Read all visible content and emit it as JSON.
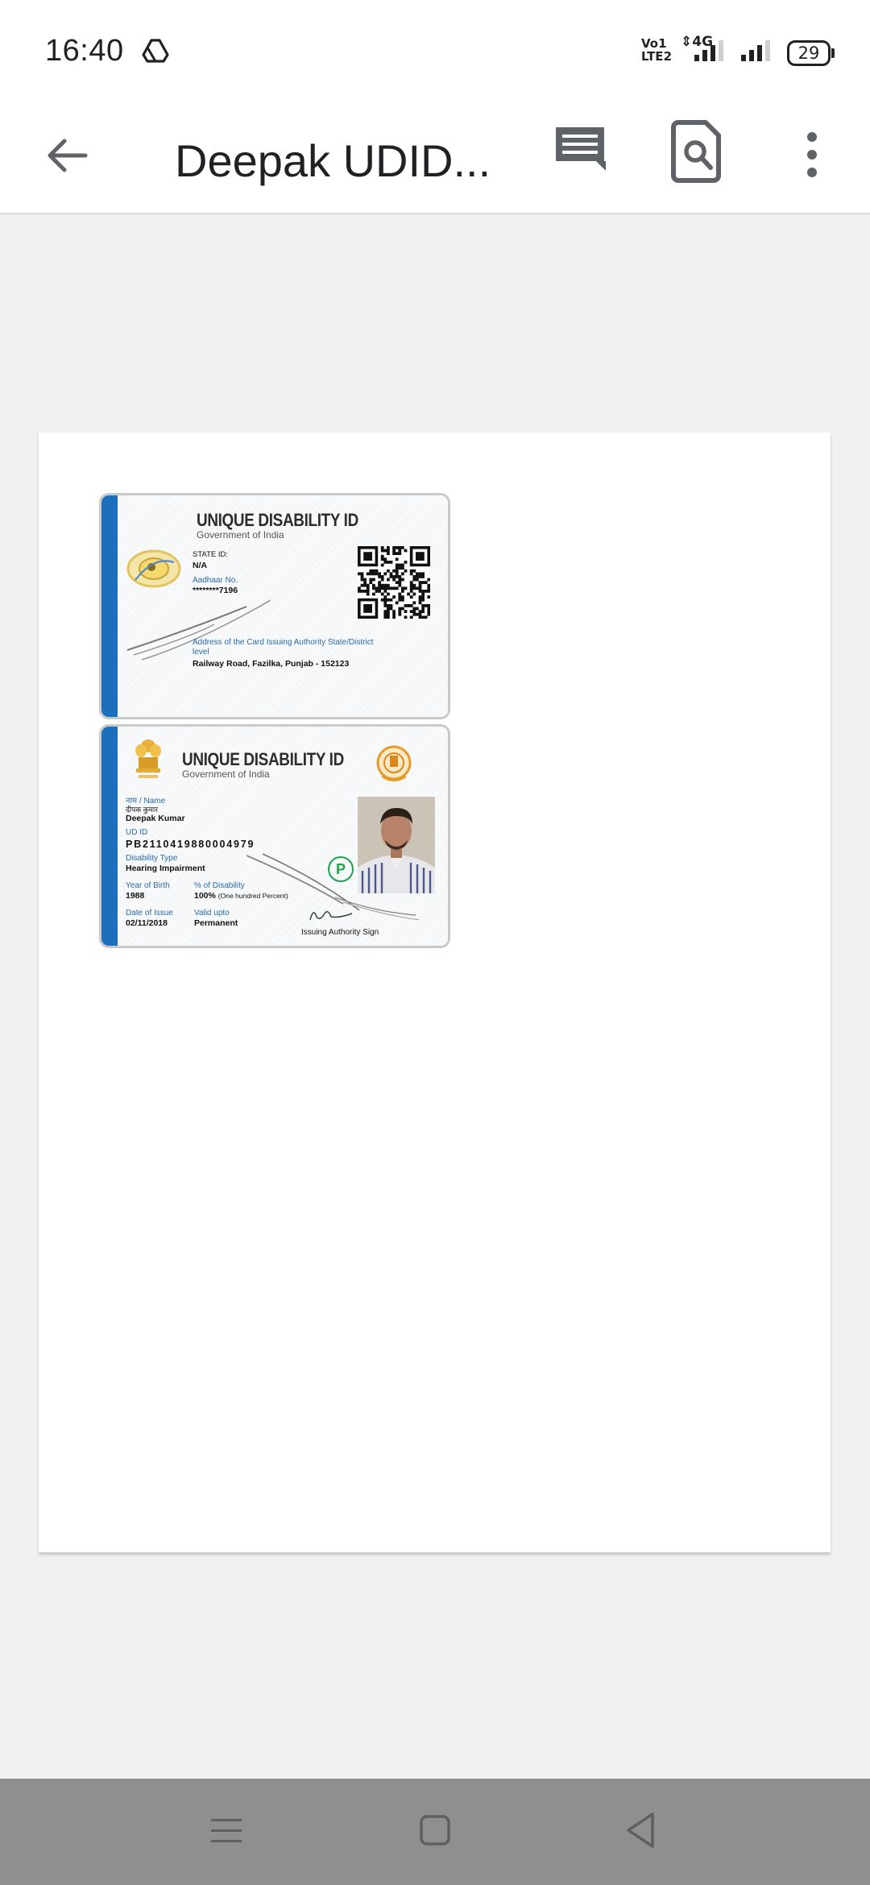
{
  "status_bar": {
    "time": "16:40",
    "network_label": "4G",
    "volte_line1": "Vo",
    "volte_line2": "LTE",
    "sim1": "1",
    "sim2": "2",
    "battery_level": "29",
    "icons": [
      "drive-icon",
      "volte-icon",
      "signal-icon",
      "signal-icon",
      "battery-icon"
    ]
  },
  "app_bar": {
    "title": "Deepak UDID...",
    "icons": [
      "back-arrow-icon",
      "comment-icon",
      "find-in-page-icon",
      "more-vert-icon"
    ]
  },
  "document": {
    "front_card": {
      "title": "UNIQUE DISABILITY ID",
      "subtitle": "Government of India",
      "state_id_label": "STATE ID:",
      "state_id_value": "N/A",
      "aadhaar_label": "Aadhaar No.",
      "aadhaar_value": "********7196",
      "address_label_line1": "Address of the Card Issuing Authority State/District",
      "address_label_line2": "level",
      "address_value": "Railway Road, Fazilka, Punjab - 152123"
    },
    "back_card": {
      "title": "UNIQUE DISABILITY ID",
      "subtitle": "Government of India",
      "name_label": "नाम / Name",
      "name_local": "दीपक कुमार",
      "name_value": "Deepak Kumar",
      "udid_label": "UD ID",
      "udid_value": "PB2110419880004979",
      "disability_type_label": "Disability Type",
      "disability_type_value": "Hearing Impairment",
      "year_of_birth_label": "Year of Birth",
      "year_of_birth_value": "1988",
      "percent_label": "% of Disability",
      "percent_value": "100%",
      "percent_words": "(One hundred Percent)",
      "date_of_issue_label": "Date of Issue",
      "date_of_issue_value": "02/11/2018",
      "valid_upto_label": "Valid upto",
      "valid_upto_value": "Permanent",
      "sign_label": "Issuing Authority Sign",
      "badge_letter": "P"
    }
  },
  "nav_bar": {
    "icons": [
      "recent-apps-icon",
      "home-icon",
      "back-icon"
    ]
  },
  "colors": {
    "card_band": "#1b6fbd",
    "label_blue": "#2a6aa6",
    "badge_green": "#1ea34a",
    "nav_bar": "#8e8f90",
    "viewer_bg": "#eff0f2"
  }
}
